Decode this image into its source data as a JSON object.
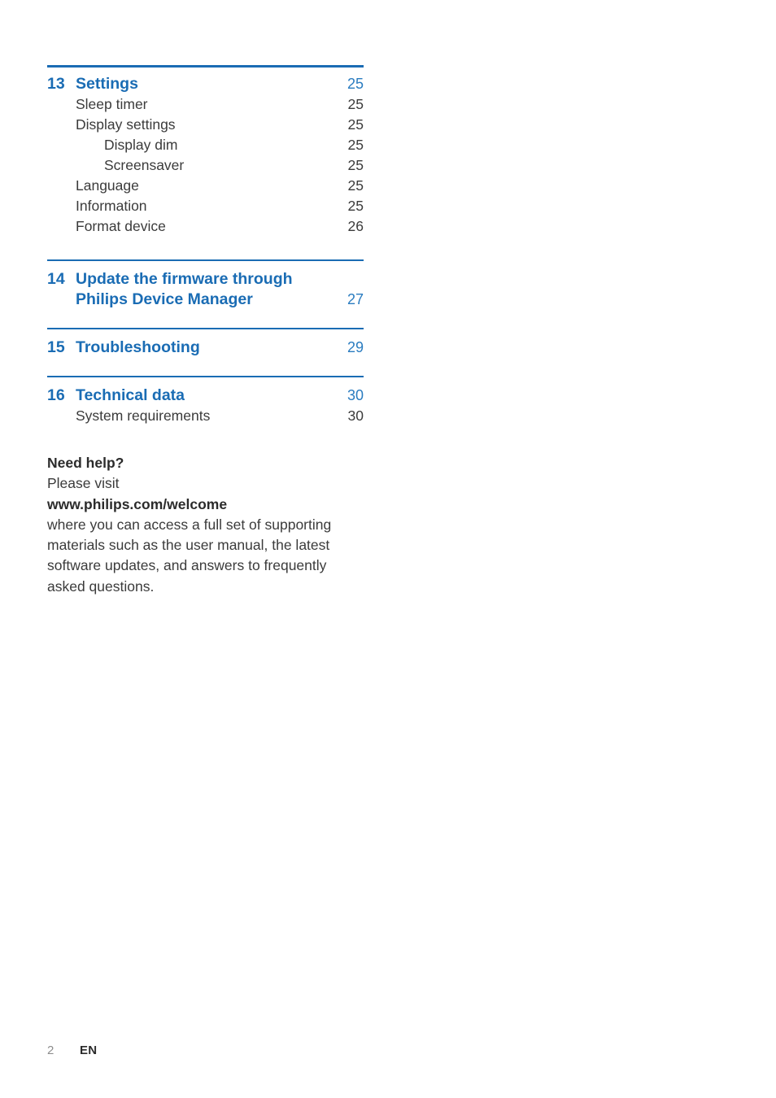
{
  "document": {
    "type": "table-of-contents"
  },
  "colors": {
    "accent_blue": "#1a6cb4",
    "page_number_blue": "#2a7cc0",
    "body_gray": "#3b3b3b",
    "footer_gray": "#8d8d8d"
  },
  "toc": {
    "sections": [
      {
        "number": "13",
        "title": "Settings",
        "page": "25",
        "entries": [
          {
            "label": "Sleep timer",
            "page": "25",
            "level": 1
          },
          {
            "label": "Display settings",
            "page": "25",
            "level": 1
          },
          {
            "label": "Display dim",
            "page": "25",
            "level": 2
          },
          {
            "label": "Screensaver",
            "page": "25",
            "level": 2
          },
          {
            "label": "Language",
            "page": "25",
            "level": 1
          },
          {
            "label": "Information",
            "page": "25",
            "level": 1
          },
          {
            "label": "Format device",
            "page": "26",
            "level": 1
          }
        ]
      },
      {
        "number": "14",
        "title_line1": "Update the firmware through",
        "title_line2": "Philips Device Manager",
        "page": "27",
        "entries": []
      },
      {
        "number": "15",
        "title": "Troubleshooting",
        "page": "29",
        "entries": []
      },
      {
        "number": "16",
        "title": "Technical data",
        "page": "30",
        "entries": [
          {
            "label": "System requirements",
            "page": "30",
            "level": 1
          }
        ]
      }
    ]
  },
  "help": {
    "heading": "Need help?",
    "line_visit": "Please visit",
    "url": "www.philips.com/welcome",
    "paragraph": "where you can access a full set of supporting materials such as the user manual, the latest software updates, and answers to frequently asked questions."
  },
  "footer": {
    "page_number": "2",
    "language": "EN"
  }
}
